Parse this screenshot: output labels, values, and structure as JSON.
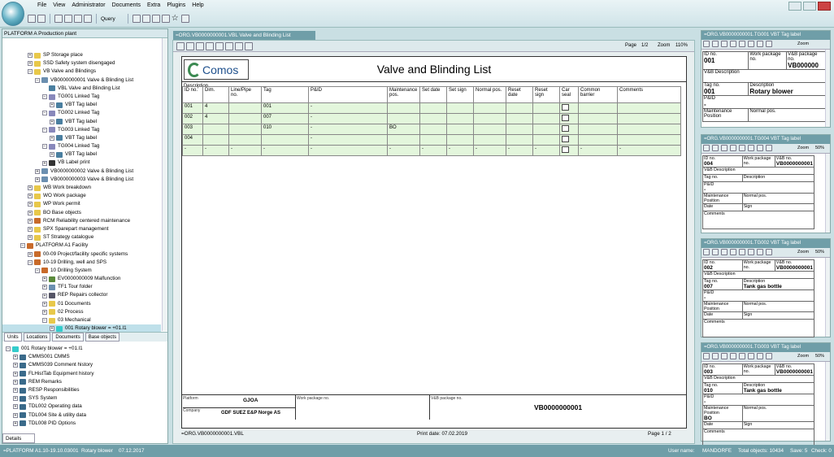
{
  "menu": [
    "File",
    "View",
    "Administrator",
    "Documents",
    "Extra",
    "Plugins",
    "Help"
  ],
  "toolbar": {
    "query_label": "Query"
  },
  "left": {
    "header": "PLATFORM A   Production plant",
    "tree": [
      {
        "indent": 3,
        "ex": "+",
        "label": "SP    Storage place",
        "icon": "#e8c84a"
      },
      {
        "indent": 3,
        "ex": "+",
        "label": "SSD   Safety system disengaged",
        "icon": "#e8c84a"
      },
      {
        "indent": 3,
        "ex": "-",
        "label": "VB   Valve and Blindings",
        "icon": "#e8c84a"
      },
      {
        "indent": 4,
        "ex": "-",
        "label": "VB0000000001   Valve & Blinding List",
        "icon": "#6b8fb0"
      },
      {
        "indent": 5,
        "ex": "",
        "label": "VBL   Valve and Blinding List",
        "icon": "#4a7fa0"
      },
      {
        "indent": 5,
        "ex": "-",
        "label": "TG001   Linked Tag",
        "icon": "#88b"
      },
      {
        "indent": 6,
        "ex": "+",
        "label": "VBT   Tag label",
        "icon": "#4a7fa0"
      },
      {
        "indent": 5,
        "ex": "-",
        "label": "TG002   Linked Tag",
        "icon": "#88b"
      },
      {
        "indent": 6,
        "ex": "+",
        "label": "VBT   Tag label",
        "icon": "#4a7fa0"
      },
      {
        "indent": 5,
        "ex": "-",
        "label": "TG003   Linked Tag",
        "icon": "#88b"
      },
      {
        "indent": 6,
        "ex": "+",
        "label": "VBT   Tag label",
        "icon": "#4a7fa0"
      },
      {
        "indent": 5,
        "ex": "-",
        "label": "TG004   Linked Tag",
        "icon": "#88b"
      },
      {
        "indent": 6,
        "ex": "+",
        "label": "VBT   Tag label",
        "icon": "#4a7fa0"
      },
      {
        "indent": 5,
        "ex": "+",
        "label": "VB   Label print",
        "icon": "#333"
      },
      {
        "indent": 4,
        "ex": "+",
        "label": "VB0000000002   Valve & Blinding List",
        "icon": "#6b8fb0"
      },
      {
        "indent": 4,
        "ex": "+",
        "label": "VB0000000003   Valve & Blinding List",
        "icon": "#6b8fb0"
      },
      {
        "indent": 3,
        "ex": "+",
        "label": "WB   Work breakdown",
        "icon": "#e8c84a"
      },
      {
        "indent": 3,
        "ex": "+",
        "label": "WO   Work package",
        "icon": "#e8c84a"
      },
      {
        "indent": 3,
        "ex": "+",
        "label": "WP   Work permit",
        "icon": "#e8c84a"
      },
      {
        "indent": 3,
        "ex": "+",
        "label": "BO   Base objects",
        "icon": "#e8c84a"
      },
      {
        "indent": 3,
        "ex": "+",
        "label": "RCM   Reliability centered maintenance",
        "icon": "#c86a2a"
      },
      {
        "indent": 3,
        "ex": "+",
        "label": "SPX   Sparepart management",
        "icon": "#e8c84a"
      },
      {
        "indent": 3,
        "ex": "+",
        "label": "ST   Strategy catalogue",
        "icon": "#e8c84a"
      },
      {
        "indent": 2,
        "ex": "-",
        "label": "PLATFORM A1   Facility",
        "icon": "#c86a2a"
      },
      {
        "indent": 3,
        "ex": "+",
        "label": "00-09   Project/facility specific systems",
        "icon": "#c86a2a"
      },
      {
        "indent": 3,
        "ex": "-",
        "label": "10-19   Drilling, well and SPS",
        "icon": "#c86a2a"
      },
      {
        "indent": 4,
        "ex": "-",
        "label": "10   Drilling System",
        "icon": "#c86a2a"
      },
      {
        "indent": 5,
        "ex": "+",
        "label": "EV0000000009   Malfunction",
        "icon": "#5a8a3a"
      },
      {
        "indent": 5,
        "ex": "+",
        "label": "TF1   Tour folder",
        "icon": "#6b8fb0"
      },
      {
        "indent": 5,
        "ex": "+",
        "label": "REP   Repairs collector",
        "icon": "#556"
      },
      {
        "indent": 5,
        "ex": "+",
        "label": "01   Documents",
        "icon": "#e8c84a"
      },
      {
        "indent": 5,
        "ex": "+",
        "label": "02   Process",
        "icon": "#e8c84a"
      },
      {
        "indent": 5,
        "ex": "-",
        "label": "03   Mechanical",
        "icon": "#e8c84a"
      },
      {
        "indent": 6,
        "ex": "+",
        "label": "001   Rotary blower  =  +01.l1",
        "icon": "#3cc",
        "sel": true
      }
    ],
    "tabs": [
      "Units",
      "Locations",
      "Documents",
      "Base objects"
    ],
    "tree2": [
      {
        "indent": 0,
        "ex": "-",
        "label": "001   Rotary blower  =  +01.l1",
        "icon": "#3cc"
      },
      {
        "indent": 1,
        "ex": "+",
        "label": "CMMS001   CMMS",
        "icon": "#3a6a8a"
      },
      {
        "indent": 1,
        "ex": "+",
        "label": "CMMS039   Comment history",
        "icon": "#3a6a8a"
      },
      {
        "indent": 1,
        "ex": "+",
        "label": "FLHistTab   Equipment history",
        "icon": "#3a6a8a"
      },
      {
        "indent": 1,
        "ex": "+",
        "label": "REM   Remarks",
        "icon": "#3a6a8a"
      },
      {
        "indent": 1,
        "ex": "+",
        "label": "RESP   Responsibilities",
        "icon": "#3a6a8a"
      },
      {
        "indent": 1,
        "ex": "+",
        "label": "SYS   System",
        "icon": "#3a6a8a"
      },
      {
        "indent": 1,
        "ex": "+",
        "label": "TDL002   Operating data",
        "icon": "#3a6a8a"
      },
      {
        "indent": 1,
        "ex": "+",
        "label": "TDL004   Site & utility data",
        "icon": "#3a6a8a"
      },
      {
        "indent": 1,
        "ex": "+",
        "label": "TDL008   PID Options",
        "icon": "#3a6a8a"
      }
    ],
    "details_tab": "Details"
  },
  "doc": {
    "tab": "=ORG.VB0000000001.VBL  Valve and Blinding List",
    "page_label": "Page",
    "page_value": "1/2",
    "zoom_label": "Zoom",
    "zoom_value": "110%",
    "brand": "Comos",
    "title": "Valve and Blinding List",
    "description_label": "Description",
    "columns": [
      "ID no.",
      "Dim.",
      "Line/Pipe no.",
      "Tag",
      "P&ID",
      "Maintenance pos.",
      "Set date",
      "Set sign",
      "Normal pos.",
      "Reset date",
      "Reset sign",
      "Car seal",
      "Common barrier",
      "Comments"
    ],
    "rows": [
      [
        "001",
        "4",
        "",
        "001",
        "-",
        "",
        "",
        "",
        "",
        "",
        "",
        "",
        "",
        ""
      ],
      [
        "002",
        "4",
        "",
        "007",
        "-",
        "",
        "",
        "",
        "",
        "",
        "",
        "",
        "",
        ""
      ],
      [
        "003",
        "",
        "",
        "010",
        "-",
        "BO",
        "",
        "",
        "",
        "",
        "",
        "",
        "",
        ""
      ],
      [
        "004",
        "",
        "",
        "",
        "-",
        "",
        "",
        "",
        "",
        "",
        "",
        "",
        "",
        ""
      ],
      [
        "-",
        "-",
        "-",
        "-",
        "-",
        "-",
        "-",
        "-",
        "-",
        "-",
        "-",
        "",
        "-",
        "-"
      ]
    ],
    "footer": {
      "platform_label": "Platform",
      "platform": "GJOA",
      "company_label": "Company",
      "company": "GDF SUEZ E&P Norge AS",
      "workpkg_label": "Work package no.",
      "vb_label": "V&B package no.",
      "vb": "VB0000000001"
    },
    "bottom_left": "=ORG.VB0000000001.VBL",
    "print_date": "Print date: 07.02.2019",
    "page_bottom": "Page    1  /  2"
  },
  "right": [
    {
      "tab": "=ORG.VB0000000001.TG001  VBT  Tag label",
      "zoom": "Zoom",
      "zoomv": "",
      "id_label": "ID no.",
      "id": "001",
      "wp_label": "Work package no.",
      "vb_label": "V&B package no.",
      "vb": "VB000000",
      "desc_label": "V&B Description",
      "tag_label": "Tag no.",
      "tag": "001",
      "descr_label": "Description",
      "descr": "Rotary blower",
      "pid_label": "P&ID",
      "pid": "-",
      "mp_label": "Maintenance Position",
      "np_label": "Normal pos.",
      "date_label": "Date",
      "sign_label": "Sign",
      "comments_label": "Comments"
    },
    {
      "tab": "=ORG.VB0000000001.TG004  VBT  Tag label",
      "zoom": "Zoom",
      "zoomv": "50%",
      "id_label": "ID no.",
      "id": "004",
      "wp_label": "Work package no.",
      "vb_label": "V&B no.",
      "vb": "VB0000000001",
      "desc_label": "V&B Description",
      "tag_label": "Tag no.",
      "tag": "",
      "descr_label": "Description",
      "descr": "",
      "pid_label": "P&ID",
      "pid": "-",
      "mp_label": "Maintenance Position",
      "np_label": "Normal pos.",
      "date_label": "Date",
      "sign_label": "Sign",
      "comments_label": "Comments"
    },
    {
      "tab": "=ORG.VB0000000001.TG002  VBT  Tag label",
      "zoom": "Zoom",
      "zoomv": "50%",
      "id_label": "ID no.",
      "id": "002",
      "wp_label": "Work package no.",
      "vb_label": "V&B no.",
      "vb": "VB0000000001",
      "desc_label": "V&B Description",
      "tag_label": "Tag no.",
      "tag": "007",
      "descr_label": "Description",
      "descr": "Tank gas bottle",
      "pid_label": "P&ID",
      "pid": "-",
      "mp_label": "Maintenance Position",
      "np_label": "Normal pos.",
      "date_label": "Date",
      "sign_label": "Sign",
      "comments_label": "Comments"
    },
    {
      "tab": "=ORG.VB0000000001.TG003  VBT  Tag label",
      "zoom": "Zoom",
      "zoomv": "50%",
      "id_label": "ID no.",
      "id": "003",
      "wp_label": "Work package no.",
      "vb_label": "V&B no.",
      "vb": "VB0000000001",
      "desc_label": "V&B Description",
      "tag_label": "Tag no.",
      "tag": "010",
      "descr_label": "Description",
      "descr": "Tank gas bottle",
      "pid_label": "P&ID",
      "pid": "-",
      "mp_label": "Maintenance Position",
      "np_label": "Normal pos.",
      "mp": "BO",
      "date_label": "Date",
      "sign_label": "Sign",
      "comments_label": "Comments"
    }
  ],
  "status": {
    "left": "=PLATFORM A1.10-19.10.03001",
    "obj": "Rotary blower",
    "date": "07.12.2017",
    "user_label": "User name:",
    "user": "MANDORFE",
    "total": "Total objects:  10434",
    "save": "Save: 5",
    "check": "Check: 0"
  }
}
